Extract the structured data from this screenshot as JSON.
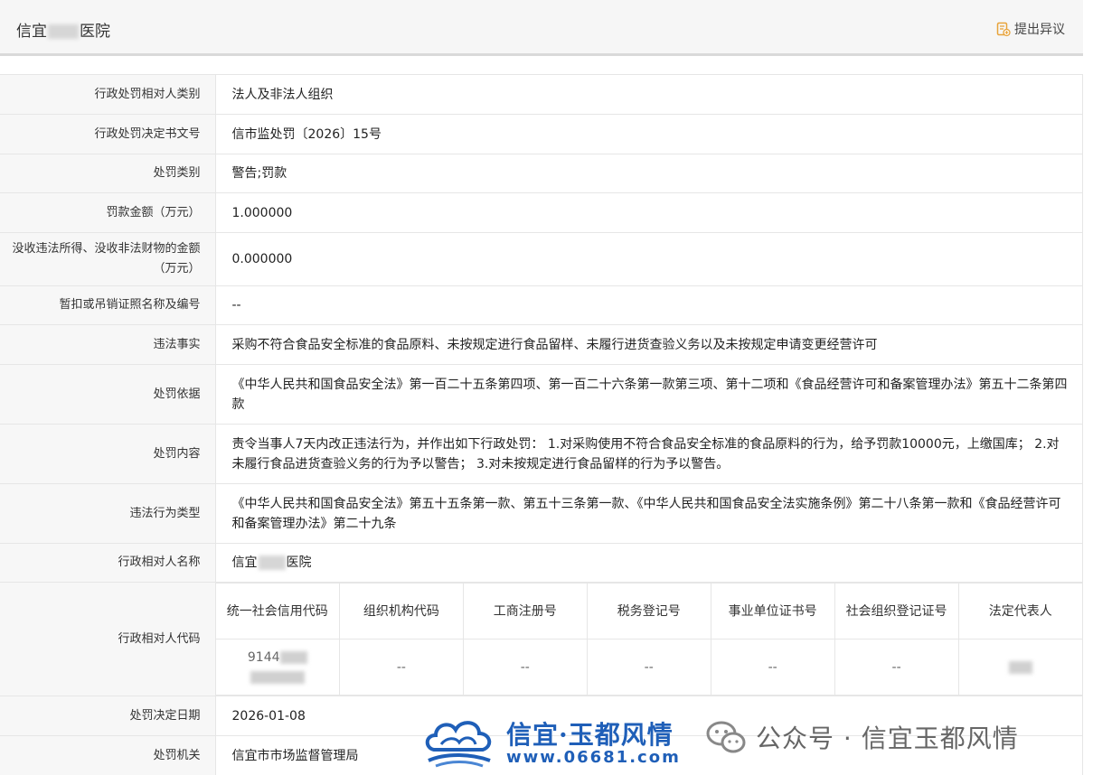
{
  "header": {
    "title_prefix": "信宜",
    "title_suffix": "医院",
    "objection_label": "提出异议"
  },
  "rows": [
    {
      "label": "行政处罚相对人类别",
      "value": "法人及非法人组织"
    },
    {
      "label": "行政处罚决定书文号",
      "value": "信市监处罚〔2026〕15号"
    },
    {
      "label": "处罚类别",
      "value": "警告;罚款"
    },
    {
      "label": "罚款金额（万元）",
      "value": "1.000000"
    },
    {
      "label": "没收违法所得、没收非法财物的金额（万元）",
      "value": "0.000000"
    },
    {
      "label": "暂扣或吊销证照名称及编号",
      "value": "--"
    },
    {
      "label": "违法事实",
      "value": "采购不符合食品安全标准的食品原料、未按规定进行食品留样、未履行进货查验义务以及未按规定申请变更经营许可"
    },
    {
      "label": "处罚依据",
      "value": "《中华人民共和国食品安全法》第一百二十五条第四项、第一百二十六条第一款第三项、第十二项和《食品经营许可和备案管理办法》第五十二条第四款"
    },
    {
      "label": "处罚内容",
      "value": "责令当事人7天内改正违法行为，并作出如下行政处罚： 1.对采购使用不符合食品安全标准的食品原料的行为，给予罚款10000元，上缴国库； 2.对未履行食品进货查验义务的行为予以警告； 3.对未按规定进行食品留样的行为予以警告。"
    },
    {
      "label": "违法行为类型",
      "value": "《中华人民共和国食品安全法》第五十五条第一款、第五十三条第一款、《中华人民共和国食品安全法实施条例》第二十八条第一款和《食品经营许可和备案管理办法》第二十九条"
    }
  ],
  "party_name": {
    "label": "行政相对人名称",
    "value_prefix": "信宜",
    "value_suffix": "医院"
  },
  "party_code": {
    "label": "行政相对人代码",
    "columns": [
      "统一社会信用代码",
      "组织机构代码",
      "工商注册号",
      "税务登记号",
      "事业单位证书号",
      "社会组织登记证号",
      "法定代表人"
    ],
    "credit_code_prefix": "9144",
    "values": [
      "--",
      "--",
      "--",
      "--",
      "--"
    ]
  },
  "date": {
    "label": "处罚决定日期",
    "value": "2026-01-08"
  },
  "authority": {
    "label": "处罚机关",
    "value": "信宜市市场监督管理局"
  },
  "watermark": {
    "brand": "信宜·玉都风情",
    "site": "www.06681.com",
    "wechat": "公众号 · 信宜玉都风情"
  },
  "colors": {
    "label_bg": "#f7f7f7",
    "border": "#e6e6e6",
    "brand_blue": "#1f5fb8"
  }
}
